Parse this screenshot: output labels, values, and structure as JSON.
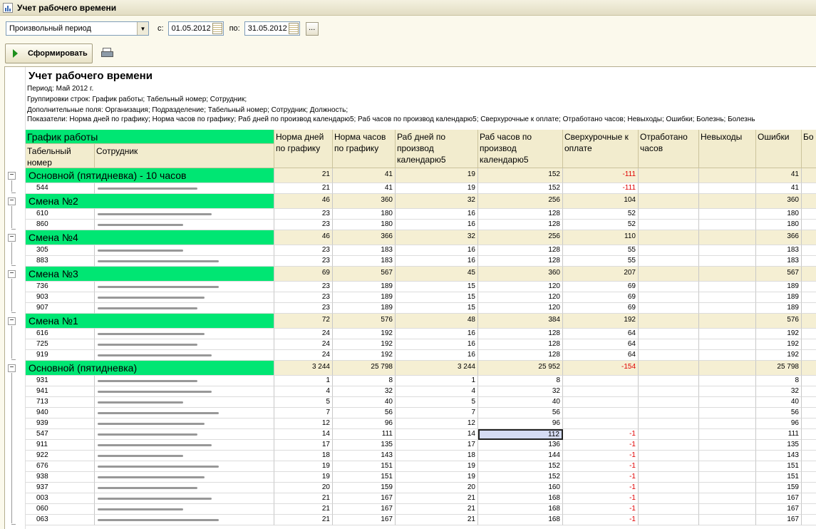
{
  "window": {
    "title": "Учет рабочего времени"
  },
  "period": {
    "select_value": "Произвольный период",
    "from_label": "с:",
    "from_value": "01.05.2012",
    "to_label": "по:",
    "to_value": "31.05.2012",
    "ellipsis_label": "..."
  },
  "toolbar": {
    "generate_label": "Сформировать"
  },
  "report": {
    "title": "Учет рабочего времени",
    "period_line": "Период: Май 2012 г.",
    "groupings_line": "Группировки строк: График работы; Табельный номер; Сотрудник;",
    "fields_line": "Дополнительные поля: Организация; Подразделение; Табельный номер; Сотрудник; Должность;",
    "indicators_line": "Показатели: Норма дней по графику; Норма часов  по графику; Раб дней по производ календарю5; Раб часов по производ календарю5; Сверхурочные к оплате; Отработано часов; Невыходы; Ошибки; Болезнь; Болезнь"
  },
  "table": {
    "group_header": "График работы",
    "tab_header": "Табельный номер",
    "emp_header": "Сотрудник",
    "columns": [
      "Норма дней по графику",
      "Норма часов по графику",
      "Раб дней по производ календарю5",
      "Раб часов по производ календарю5",
      "Сверхурочные к оплате",
      "Отработано часов",
      "Невыходы",
      "Ошибки",
      "Бо"
    ],
    "groups": [
      {
        "name": "Основной (пятидневка) - 10 часов",
        "values": [
          "21",
          "41",
          "19",
          "152",
          "-111",
          "",
          "",
          "41"
        ],
        "rows": [
          {
            "tab": "544",
            "values": [
              "21",
              "41",
              "19",
              "152",
              "-111",
              "",
              "",
              "41"
            ]
          }
        ]
      },
      {
        "name": "Смена №2",
        "values": [
          "46",
          "360",
          "32",
          "256",
          "104",
          "",
          "",
          "360"
        ],
        "rows": [
          {
            "tab": "610",
            "values": [
              "23",
              "180",
              "16",
              "128",
              "52",
              "",
              "",
              "180"
            ]
          },
          {
            "tab": "860",
            "values": [
              "23",
              "180",
              "16",
              "128",
              "52",
              "",
              "",
              "180"
            ]
          }
        ]
      },
      {
        "name": "Смена №4",
        "values": [
          "46",
          "366",
          "32",
          "256",
          "110",
          "",
          "",
          "366"
        ],
        "rows": [
          {
            "tab": "305",
            "values": [
              "23",
              "183",
              "16",
              "128",
              "55",
              "",
              "",
              "183"
            ]
          },
          {
            "tab": "883",
            "values": [
              "23",
              "183",
              "16",
              "128",
              "55",
              "",
              "",
              "183"
            ]
          }
        ]
      },
      {
        "name": "Смена №3",
        "values": [
          "69",
          "567",
          "45",
          "360",
          "207",
          "",
          "",
          "567"
        ],
        "rows": [
          {
            "tab": "736",
            "values": [
              "23",
              "189",
              "15",
              "120",
              "69",
              "",
              "",
              "189"
            ]
          },
          {
            "tab": "903",
            "values": [
              "23",
              "189",
              "15",
              "120",
              "69",
              "",
              "",
              "189"
            ]
          },
          {
            "tab": "907",
            "values": [
              "23",
              "189",
              "15",
              "120",
              "69",
              "",
              "",
              "189"
            ]
          }
        ]
      },
      {
        "name": "Смена №1",
        "values": [
          "72",
          "576",
          "48",
          "384",
          "192",
          "",
          "",
          "576"
        ],
        "rows": [
          {
            "tab": "616",
            "values": [
              "24",
              "192",
              "16",
              "128",
              "64",
              "",
              "",
              "192"
            ]
          },
          {
            "tab": "725",
            "values": [
              "24",
              "192",
              "16",
              "128",
              "64",
              "",
              "",
              "192"
            ]
          },
          {
            "tab": "919",
            "values": [
              "24",
              "192",
              "16",
              "128",
              "64",
              "",
              "",
              "192"
            ]
          }
        ]
      },
      {
        "name": "Основной (пятидневка)",
        "values": [
          "3 244",
          "25 798",
          "3 244",
          "25 952",
          "-154",
          "",
          "",
          "25 798"
        ],
        "rows": [
          {
            "tab": "931",
            "values": [
              "1",
              "8",
              "1",
              "8",
              "",
              "",
              "",
              "8"
            ]
          },
          {
            "tab": "941",
            "values": [
              "4",
              "32",
              "4",
              "32",
              "",
              "",
              "",
              "32"
            ]
          },
          {
            "tab": "713",
            "values": [
              "5",
              "40",
              "5",
              "40",
              "",
              "",
              "",
              "40"
            ]
          },
          {
            "tab": "940",
            "values": [
              "7",
              "56",
              "7",
              "56",
              "",
              "",
              "",
              "56"
            ]
          },
          {
            "tab": "939",
            "values": [
              "12",
              "96",
              "12",
              "96",
              "",
              "",
              "",
              "96"
            ]
          },
          {
            "tab": "547",
            "values": [
              "14",
              "111",
              "14",
              "112",
              "-1",
              "",
              "",
              "111"
            ]
          },
          {
            "tab": "911",
            "values": [
              "17",
              "135",
              "17",
              "136",
              "-1",
              "",
              "",
              "135"
            ]
          },
          {
            "tab": "922",
            "values": [
              "18",
              "143",
              "18",
              "144",
              "-1",
              "",
              "",
              "143"
            ]
          },
          {
            "tab": "676",
            "values": [
              "19",
              "151",
              "19",
              "152",
              "-1",
              "",
              "",
              "151"
            ]
          },
          {
            "tab": "938",
            "values": [
              "19",
              "151",
              "19",
              "152",
              "-1",
              "",
              "",
              "151"
            ]
          },
          {
            "tab": "937",
            "values": [
              "20",
              "159",
              "20",
              "160",
              "-1",
              "",
              "",
              "159"
            ]
          },
          {
            "tab": "003",
            "values": [
              "21",
              "167",
              "21",
              "168",
              "-1",
              "",
              "",
              "167"
            ]
          },
          {
            "tab": "060",
            "values": [
              "21",
              "167",
              "21",
              "168",
              "-1",
              "",
              "",
              "167"
            ]
          },
          {
            "tab": "063",
            "values": [
              "21",
              "167",
              "21",
              "168",
              "-1",
              "",
              "",
              "167"
            ]
          }
        ]
      }
    ]
  },
  "colors": {
    "group_fill": "#00e673",
    "header_fill": "#f2ecce",
    "negative": "#e00000",
    "selection": "#d5dcf3"
  },
  "icons": [
    "window-icon",
    "dropdown-arrow-icon",
    "calendar-icon",
    "play-icon",
    "print-icon",
    "collapse-icon"
  ]
}
